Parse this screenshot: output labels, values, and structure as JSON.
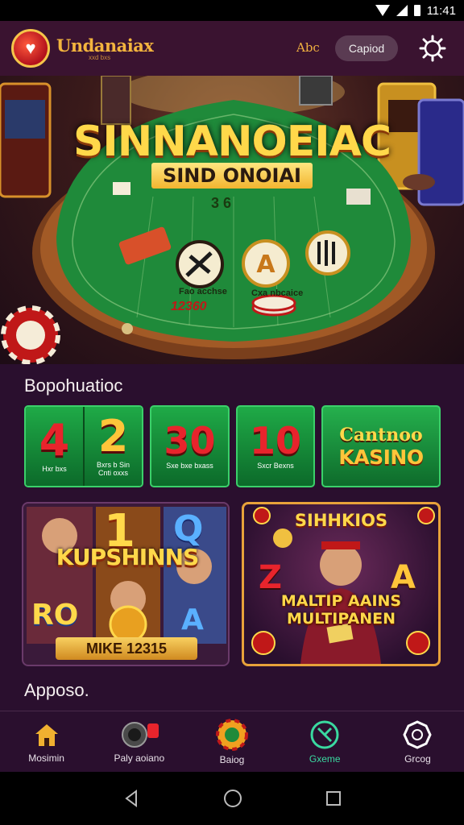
{
  "status_bar": {
    "time": "11:41"
  },
  "header": {
    "brand_name": "Undanaiax",
    "brand_sub": "xxd bxs",
    "link_label": "Abc",
    "pill_label": "Capiod",
    "settings_icon": "gear-icon"
  },
  "hero": {
    "title": "SINNANOEIAC",
    "subtitle": "SIND ONOIAI",
    "bet_number": "3 6",
    "red_amount": "12360",
    "label_a": "Fao acchse",
    "label_b": "Cxa nbcaice"
  },
  "section_one": {
    "title": "Bopohuatioc"
  },
  "tiles": [
    {
      "num": "4",
      "caption": "Hxr bxs",
      "color": "#e8242c"
    },
    {
      "num": "2",
      "caption": "Bxrs b Sin\nCnti oxxs",
      "color": "#ffc53a"
    },
    {
      "num": "30",
      "caption": "Sxe bxe bxass",
      "color": "#e8242c"
    },
    {
      "num": "10",
      "caption": "Sxcr Bexns",
      "color": "#e8242c"
    }
  ],
  "kasino_tile": {
    "top": "Cantnoo",
    "main": "KASINO"
  },
  "promo_left": {
    "title": "KUPSHINNS",
    "bottom": "MIKE 12315",
    "big_num": "1",
    "ro": "RO",
    "a": "A"
  },
  "promo_right": {
    "title": "SIHHKIOS",
    "text_line1": "MALTIP AAINS",
    "text_line2": "MULTIPANEN",
    "z": "Z",
    "a": "A"
  },
  "section_two": {
    "title": "Apposo."
  },
  "bottom_nav": [
    {
      "label": "Mosimin",
      "icon": "home-icon",
      "active": false
    },
    {
      "label": "Paly aoiano",
      "icon": "slot-machine-icon",
      "active": false
    },
    {
      "label": "Baiog",
      "icon": "poker-chip-icon",
      "active": false
    },
    {
      "label": "Gxeme",
      "icon": "compass-icon",
      "active": true
    },
    {
      "label": "Grcog",
      "icon": "settings-icon",
      "active": false
    }
  ],
  "colors": {
    "accent": "#f3b43e",
    "active": "#3ad9a0",
    "felt": "#1f8a3a",
    "background": "#2a0f2e"
  }
}
